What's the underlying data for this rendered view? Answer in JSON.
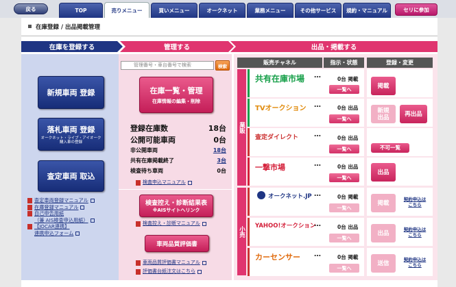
{
  "nav": {
    "back": "戻る",
    "tabs": [
      "TOP",
      "売りメニュー",
      "買いメニュー",
      "オークネット",
      "業務メニュー",
      "その他サービス",
      "規約・マニュアル"
    ],
    "active_tab": 1,
    "join": "セリに参加"
  },
  "breadcrumb": "在庫登録 / 出品掲載管理",
  "sections": {
    "register": "在庫を登録する",
    "manage": "管理する",
    "listing": "出品・掲載する"
  },
  "register": {
    "btn_new": "新規車両 登録",
    "btn_fallen": "落札車両 登録",
    "btn_fallen_sub": "オークネット・ライブ・アイオーク\n購入車の登録",
    "btn_appraisal": "査定車両 取込",
    "manuals": [
      {
        "text": "査定車両登録マニュアル",
        "ext": true
      },
      {
        "text": "在庫登録マニュアル",
        "ext": true
      },
      {
        "text": "自己申告用紙",
        "ext": false
      },
      {
        "text": "（兼 AIS検査申込用紙）",
        "ext": true
      },
      {
        "text": "【JOCAR連携】",
        "ext": false
      },
      {
        "text": "連携申込フォーム",
        "ext": true
      }
    ]
  },
  "manage": {
    "search_placeholder": "管理番号・車台番号で検索",
    "search_btn": "検索",
    "list_btn": "在庫一覧・管理",
    "list_btn_sub": "在庫情報の編集・削除",
    "stock": [
      {
        "label": "登録在庫数",
        "value": "18台",
        "size": "big",
        "link": false
      },
      {
        "label": "公開可能車両",
        "value": "0台",
        "size": "big",
        "link": false
      },
      {
        "label": "非公開車両",
        "value": "18台",
        "size": "sm",
        "link": true
      },
      {
        "label": "共有在庫掲載終了",
        "value": "3台",
        "size": "sm",
        "link": true
      },
      {
        "label": "検査待ち車両",
        "value": "0台",
        "size": "sm",
        "link": false
      }
    ],
    "inspect_manual": "検査申込マニュアル",
    "ais_btn": "検査控え・診断結果表",
    "ais_btn_sub": "※AISサイトへリンク",
    "ais_manual": "検査控え・診断マニュアル",
    "quality_btn": "車両品質評価書",
    "quality_manual": "車両品質評価書マニュアル",
    "quality_order": "評価書台紙注文はこちら"
  },
  "listing": {
    "head_channel": "販売チャネル",
    "head_status": "指示・状態",
    "head_register": "登録・変更",
    "group_gyohan": "業販",
    "group_kouri": "小売",
    "list_label": "一覧へ",
    "channels": [
      {
        "name": "共有在庫市場",
        "color": "#18a04a",
        "count": "0台",
        "state": "掲載",
        "actions": [
          "掲載"
        ]
      },
      {
        "name": "TVオークション",
        "color": "#e08a0a",
        "count": "0台",
        "state": "出品",
        "actions": [
          "新規\n出品",
          "再出品"
        ]
      },
      {
        "name": "査定ダイレクト",
        "color": "#c33",
        "count": "0台",
        "state": "出品",
        "actions": [
          "不可一覧"
        ]
      },
      {
        "name": "一撃市場",
        "color": "#d4203a",
        "count": "0台",
        "state": "出品",
        "actions": [
          "出品"
        ]
      },
      {
        "name": "オークネット.JP",
        "color": "#1f3583",
        "count": "0台",
        "state": "掲載",
        "actions": [
          "掲載",
          "契約申込は\nこちら"
        ]
      },
      {
        "name": "YAHOO!オークション",
        "color": "#d4203a",
        "count": "0台",
        "state": "出品",
        "actions": [
          "出品",
          "契約申込は\nこちら"
        ]
      },
      {
        "name": "カーセンサー",
        "color": "#e06a0c",
        "count": "0台",
        "state": "掲載",
        "actions": [
          "送信",
          "契約申込は\nこちら"
        ]
      }
    ]
  }
}
